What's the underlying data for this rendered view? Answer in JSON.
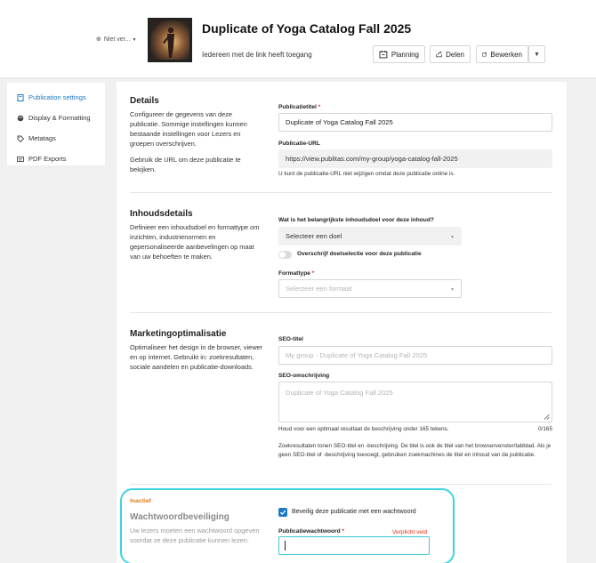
{
  "header": {
    "visibility": "Niet ver...",
    "title": "Duplicate of Yoga Catalog Fall 2025",
    "subtitle": "Iedereen met de link heeft toegang",
    "buttons": {
      "planning": "Planning",
      "delen": "Delen",
      "bewerken": "Bewerken"
    }
  },
  "sidebar": {
    "items": [
      {
        "label": "Publication settings",
        "icon": "publication-icon",
        "active": true
      },
      {
        "label": "Display & Formatting",
        "icon": "palette-icon",
        "active": false
      },
      {
        "label": "Metatags",
        "icon": "tag-icon",
        "active": false
      },
      {
        "label": "PDF Exports",
        "icon": "pdf-icon",
        "active": false
      }
    ]
  },
  "details": {
    "title": "Details",
    "desc1": "Configureer de gegevens van deze publicatie. Sommige instellingen kunnen bestaande instellingen voor Lezers en groepen overschrijven.",
    "desc2": "Gebruik de URL om deze publicatie te bekijken.",
    "title_label": "Publicatietitel",
    "title_value": "Duplicate of Yoga Catalog Fall 2025",
    "url_label": "Publicatie-URL",
    "url_value": "https://view.publitas.com/my-group/yoga-catalog-fall-2025",
    "url_hint": "U kunt de publicatie-URL niet wijzigen omdat deze publicatie online is."
  },
  "content": {
    "title": "Inhoudsdetails",
    "desc": "Definieer een inhoudsdoel en formattype om inzichten, industrienormen en gepersonaliseerde aanbevelingen op maat van uw behoeften te maken.",
    "goal_label": "Wat is het belangrijkste inhoudsdoel voor deze inhoud?",
    "goal_value": "Selecteer een doel",
    "override_label": "Overschrijf doelselectie voor deze publicatie",
    "format_label": "Formattype",
    "format_placeholder": "Selecteer een formaat"
  },
  "marketing": {
    "title": "Marketingoptimalisatie",
    "desc": "Optimaliseer het design in de browser, viewer en op internet. Gebruikt in: zoekresultaten, sociale aandelen en publicatie-downloads.",
    "seo_title_label": "SEO-titel",
    "seo_title_placeholder": "My group - Duplicate of Yoga Catalog Fall 2025",
    "seo_desc_label": "SEO-omschrijving",
    "seo_desc_placeholder": "Duplicate of Yoga Catalog Fall 2025",
    "seo_desc_hint": "Houd voor een optimaal resultaat de beschrijving onder 165 tekens.",
    "seo_desc_count": "0/165",
    "seo_info": "Zoekresultaten tonen SEO-titel en -beschrijving. De titel is ook de titel van het browservenster/tabblad. Als je geen SEO-titel of -beschrijving toevoegt, gebruiken zoekmachines de titel en inhoud van de publicatie."
  },
  "password": {
    "status": "Inactief",
    "title": "Wachtwoordbeveiliging",
    "desc": "Uw lezers moeten een wachtwoord opgeven voordat ze deze publicatie kunnen lezen.",
    "checkbox_label": "Beveilig deze publicatie met een wachtwoord",
    "checked": true,
    "field_label": "Publicatiewachtwoord",
    "error": "Verplicht veld",
    "value": ""
  },
  "colors": {
    "accent": "#1b79c6",
    "highlight": "#3fd3e0",
    "required": "#e0321f",
    "inactive": "#e07a1f"
  }
}
